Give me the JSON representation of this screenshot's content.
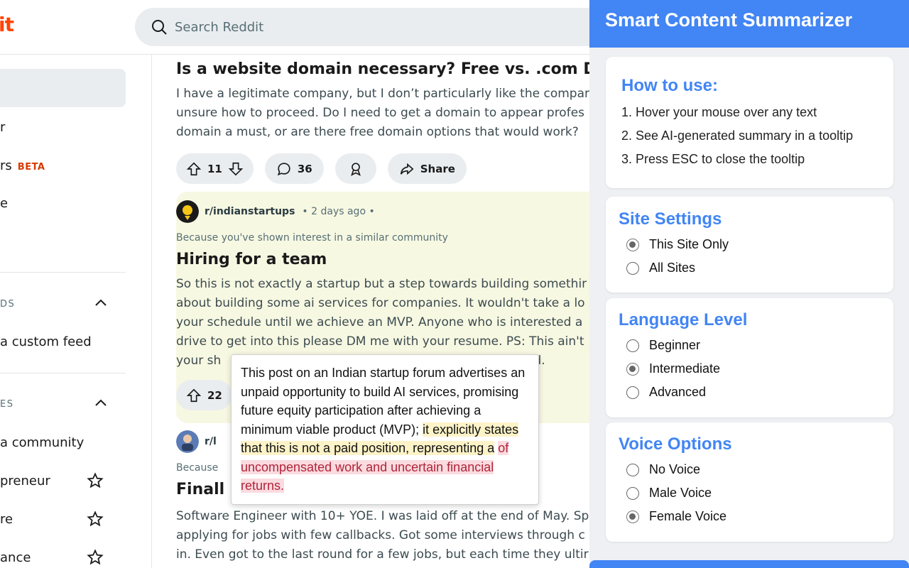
{
  "header": {
    "logo_text": "it",
    "search": {
      "placeholder": "Search Reddit"
    }
  },
  "sidebar": {
    "items": [
      {
        "label": "r"
      },
      {
        "label": "rs",
        "badge": "BETA"
      },
      {
        "label": "e"
      }
    ],
    "section_feeds": {
      "label": "DS"
    },
    "create_feed": "a custom feed",
    "section_communities": {
      "label": "ES"
    },
    "create_community": "a community",
    "communities": [
      {
        "label": "preneur"
      },
      {
        "label": "re"
      },
      {
        "label": "ance"
      }
    ]
  },
  "feed": {
    "post1": {
      "title": "Is a website domain necessary? Free vs. .com Doma",
      "body": [
        "I have a legitimate company, but I don’t particularly like the compar",
        "unsure how to proceed. Do I need to get a domain to appear profes",
        "domain a must, or are there free domain options that would work?"
      ],
      "upvotes": "11",
      "comments": "36",
      "share_label": "Share"
    },
    "post2": {
      "community": "r/indianstartups",
      "time": "• 2 days ago •",
      "reason": "Because you've shown interest in a similar community",
      "title": "Hiring for a team",
      "body": [
        "So this is not exactly a startup but a step towards building somethir",
        "about building some ai services for companies. It wouldn't take a lo",
        "your schedule until we achieve an MVP. Anyone who is interested a",
        "drive to get into this please DM me with your resume. PS: This ain't",
        "your sh",
        "uild."
      ],
      "upvotes": "22"
    },
    "post3": {
      "community": "r/l",
      "reason": "Because",
      "title": "Finall",
      "body": [
        "Software Engineer with 10+ YOE. I was laid off at the end of May. Sp",
        "applying for jobs with few callbacks. Got some interviews through c",
        "in. Even got to the last round for a few jobs, but each time they ultir"
      ]
    }
  },
  "tooltip": {
    "part1": "This post on an Indian startup forum advertises an unpaid opportunity to build AI services, promising future equity participation after achieving a minimum viable product (MVP);",
    "part2": "it explicitly states that this is not a paid position, representing a",
    "part3": "of uncompensated work and uncertain financial returns."
  },
  "extension": {
    "title": "Smart Content Summarizer",
    "howto": {
      "title": "How to use:",
      "steps": [
        "1. Hover your mouse over any text",
        "2. See AI-generated summary in a tooltip",
        "3. Press ESC to close the tooltip"
      ]
    },
    "site_settings": {
      "title": "Site Settings",
      "options": [
        "This Site Only",
        "All Sites"
      ],
      "selected": "This Site Only"
    },
    "language_level": {
      "title": "Language Level",
      "options": [
        "Beginner",
        "Intermediate",
        "Advanced"
      ],
      "selected": "Intermediate"
    },
    "voice_options": {
      "title": "Voice Options",
      "options": [
        "No Voice",
        "Male Voice",
        "Female Voice"
      ],
      "selected": "Female Voice"
    },
    "accent_color": "#4285f4"
  }
}
